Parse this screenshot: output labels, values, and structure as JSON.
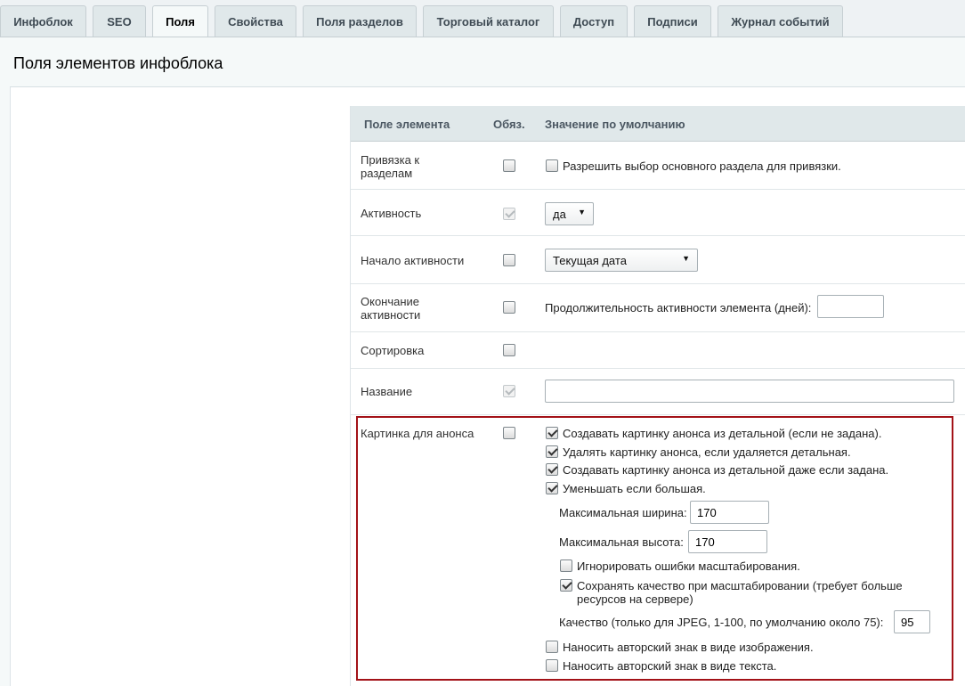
{
  "tabs": [
    "Инфоблок",
    "SEO",
    "Поля",
    "Свойства",
    "Поля разделов",
    "Торговый каталог",
    "Доступ",
    "Подписи",
    "Журнал событий"
  ],
  "page_title": "Поля элементов инфоблока",
  "table_header": {
    "field": "Поле элемента",
    "required": "Обяз.",
    "default": "Значение по умолчанию"
  },
  "rows": {
    "section_link": {
      "label": "Привязка к разделам",
      "option": "Разрешить выбор основного раздела для привязки."
    },
    "active": {
      "label": "Активность",
      "value": "да"
    },
    "active_from": {
      "label": "Начало активности",
      "value": "Текущая дата"
    },
    "active_to": {
      "label": "Окончание активности",
      "duration_label": "Продолжительность активности элемента (дней):",
      "duration_value": ""
    },
    "sort": {
      "label": "Сортировка"
    },
    "name": {
      "label": "Название",
      "value": ""
    },
    "preview_picture": {
      "label": "Картинка для анонса",
      "options": [
        "Создавать картинку анонса из детальной (если не задана).",
        "Удалять картинку анонса, если удаляется детальная.",
        "Создавать картинку анонса из детальной даже если задана.",
        "Уменьшать если большая."
      ],
      "max_width_label": "Максимальная ширина:",
      "max_width_value": "170",
      "max_height_label": "Максимальная высота:",
      "max_height_value": "170",
      "ignore_errors": "Игнорировать ошибки масштабирования.",
      "keep_quality_line1": "Сохранять качество при масштабировании (требует больше",
      "keep_quality_line2": "ресурсов на сервере)",
      "quality_label": "Качество (только для JPEG, 1-100, по умолчанию около 75):",
      "quality_value": "95",
      "watermark_image": "Наносить авторский знак в виде изображения.",
      "watermark_text": "Наносить авторский знак в виде текста."
    }
  }
}
